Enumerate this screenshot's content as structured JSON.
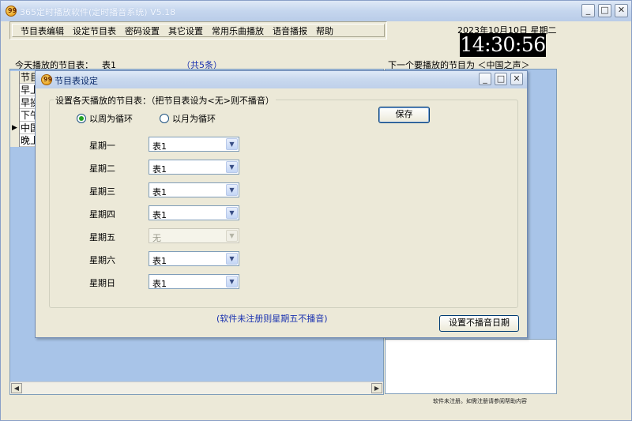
{
  "main": {
    "title": "365定时播放软件(定时播音系统) V5.18",
    "menu": [
      "节目表编辑",
      "设定节目表",
      "密码设置",
      "其它设置",
      "常用乐曲播放",
      "语音播报",
      "帮助"
    ],
    "date": "2023年10月10日  星期二",
    "clock": "14:30:56",
    "today_label": "今天播放的节目表：",
    "today_table": "表1",
    "count_label": "（共5条）",
    "next_label": "下一个要播放的节目为 ＜中国之声＞",
    "grid": {
      "header": "节目",
      "rows": [
        "早上",
        "早操",
        "下午",
        "中国",
        "晚上"
      ],
      "current_row": 3
    },
    "register_note": "软件未注册。如需注册请参阅帮助内容"
  },
  "dialog": {
    "title": "节目表设定",
    "caption": "设置各天播放的节目表：（把节目表设为<无>则不播音）",
    "radio_week": "以周为循环",
    "radio_month": "以月为循环",
    "save": "保存",
    "days": [
      {
        "label": "星期一",
        "value": "表1",
        "disabled": false
      },
      {
        "label": "星期二",
        "value": "表1",
        "disabled": false
      },
      {
        "label": "星期三",
        "value": "表1",
        "disabled": false
      },
      {
        "label": "星期四",
        "value": "表1",
        "disabled": false
      },
      {
        "label": "星期五",
        "value": "无",
        "disabled": true
      },
      {
        "label": "星期六",
        "value": "表1",
        "disabled": false
      },
      {
        "label": "星期日",
        "value": "表1",
        "disabled": false
      }
    ],
    "unregistered_note": "(软件未注册则星期五不播音)",
    "nomute_button": "设置不播音日期"
  },
  "icons": {
    "minimize": "minimize-icon",
    "maximize": "maximize-icon",
    "close": "close-icon",
    "dropdown": "chevron-down-icon",
    "logo": "app-logo-icon"
  },
  "colors": {
    "accent_blue": "#1a32b0",
    "panel_blue": "#a8c4e8"
  }
}
